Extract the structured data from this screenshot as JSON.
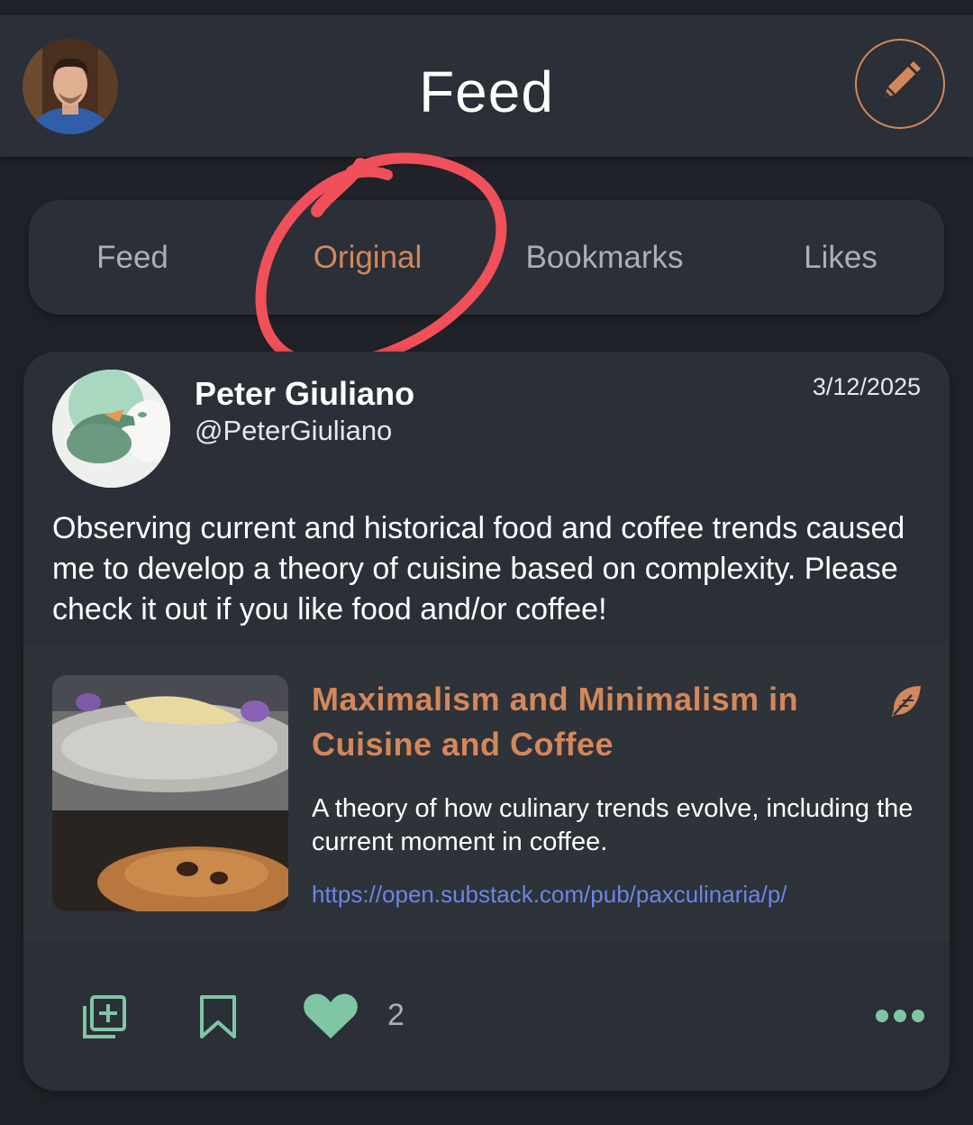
{
  "header": {
    "title": "Feed",
    "compose_icon": "pencil-icon",
    "accent": "#d4875a"
  },
  "tabs": [
    {
      "label": "Feed",
      "active": false
    },
    {
      "label": "Original",
      "active": true
    },
    {
      "label": "Bookmarks",
      "active": false
    },
    {
      "label": "Likes",
      "active": false
    }
  ],
  "post": {
    "author_name": "Peter Giuliano",
    "author_handle": "@PeterGiuliano",
    "date": "3/12/2025",
    "text": "Observing current and historical  food and coffee trends caused me to develop a theory of  cuisine based on complexity. Please check it out if you like food and/or coffee!",
    "link": {
      "title": "Maximalism and Minimalism in Cuisine and Coffee",
      "description": "A theory of how culinary trends evolve, including the current moment in coffee.",
      "url": "https://open.substack.com/pub/paxculinaria/p/",
      "icon": "feather-icon"
    },
    "like_count": "2",
    "action_icons": [
      "add-to-collection-icon",
      "bookmark-icon",
      "heart-icon",
      "more-icon"
    ]
  },
  "colors": {
    "background": "#1f2228",
    "surface": "#2b2f37",
    "accent": "#d4875a",
    "green": "#7fc6a4",
    "link": "#6b86e6",
    "annotation": "#f0505a"
  }
}
